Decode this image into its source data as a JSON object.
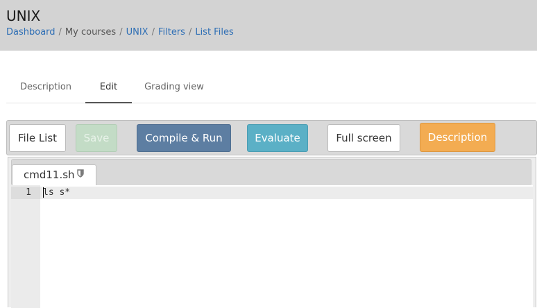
{
  "header": {
    "title": "UNIX",
    "breadcrumb": [
      {
        "label": "Dashboard"
      },
      {
        "label": "My courses"
      },
      {
        "label": "UNIX"
      },
      {
        "label": "Filters"
      },
      {
        "label": "List Files"
      }
    ],
    "separator": "/"
  },
  "tabs": [
    {
      "label": "Description",
      "active": false
    },
    {
      "label": "Edit",
      "active": true
    },
    {
      "label": "Grading view",
      "active": false
    }
  ],
  "toolbar": {
    "file_list_label": "File List",
    "save_label": "Save",
    "compile_run_label": "Compile & Run",
    "evaluate_label": "Evaluate",
    "fullscreen_label": "Full screen",
    "description_label": "Description"
  },
  "editor": {
    "file_tab": {
      "name": "cmd11.sh",
      "icon": "lock-icon"
    },
    "lines": [
      {
        "number": "1",
        "code": "ls s*"
      }
    ]
  },
  "colors": {
    "header_bg": "#d3d3d3",
    "link": "#2f6fb5",
    "compile_run": "#5d7ea2",
    "evaluate": "#5bb0c6",
    "description": "#f3ac52",
    "save_disabled": "#c3dcc6"
  }
}
